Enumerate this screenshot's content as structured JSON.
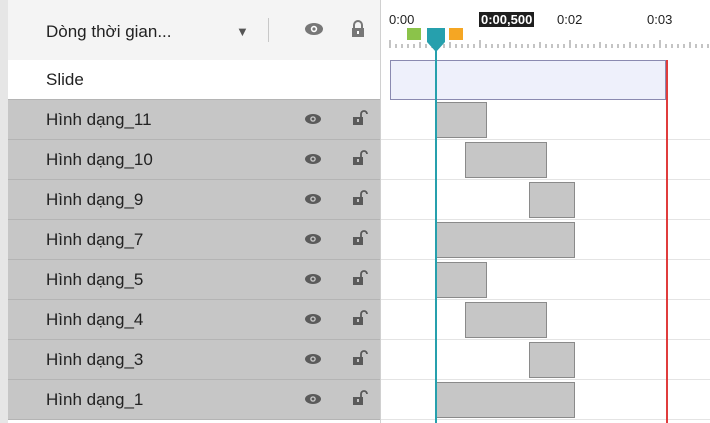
{
  "header": {
    "title": "Dòng thời gian...",
    "dropdown_icon": "caret-down-icon",
    "visibility_icon": "eye-icon",
    "lock_icon": "lock-icon"
  },
  "rows": [
    {
      "label": "Slide",
      "kind": "slide"
    },
    {
      "label": "Hình dạng_11",
      "kind": "layer"
    },
    {
      "label": "Hình dạng_10",
      "kind": "layer"
    },
    {
      "label": "Hình dạng_9",
      "kind": "layer"
    },
    {
      "label": "Hình dạng_7",
      "kind": "layer"
    },
    {
      "label": "Hình dạng_5",
      "kind": "layer"
    },
    {
      "label": "Hình dạng_4",
      "kind": "layer"
    },
    {
      "label": "Hình dạng_3",
      "kind": "layer"
    },
    {
      "label": "Hình dạng_1",
      "kind": "layer"
    }
  ],
  "ruler": {
    "labels": [
      "0:00",
      "0:02",
      "0:03"
    ],
    "current_time": "0:00,500"
  },
  "colors": {
    "playhead": "#26a0ad",
    "end_marker": "#e03c3c",
    "start_marker": "#8bc34a",
    "end_cue": "#f5a623"
  }
}
